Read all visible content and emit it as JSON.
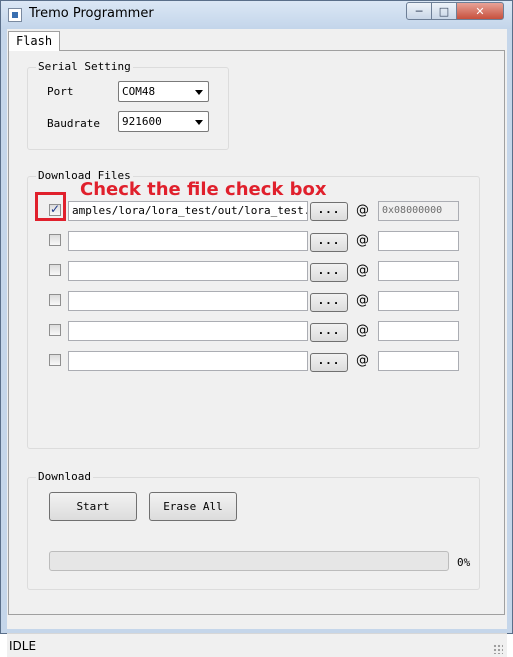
{
  "window": {
    "title": "Tremo Programmer",
    "minimize_glyph": "─",
    "maximize_glyph": "□",
    "close_glyph": "✕"
  },
  "tabs": [
    {
      "label": "Flash",
      "selected": true
    }
  ],
  "serial_setting": {
    "title": "Serial Setting",
    "port_label": "Port",
    "port_value": "COM48",
    "baudrate_label": "Baudrate",
    "baudrate_value": "921600"
  },
  "download_files": {
    "title": "Download Files",
    "browse_label": "...",
    "at_symbol": "@",
    "rows": [
      {
        "checked": true,
        "path": "amples/lora/lora_test/out/lora_test.bin",
        "address": "0x08000000",
        "address_disabled": true
      },
      {
        "checked": false,
        "path": "",
        "address": ""
      },
      {
        "checked": false,
        "path": "",
        "address": ""
      },
      {
        "checked": false,
        "path": "",
        "address": ""
      },
      {
        "checked": false,
        "path": "",
        "address": ""
      },
      {
        "checked": false,
        "path": "",
        "address": ""
      }
    ]
  },
  "download": {
    "title": "Download",
    "start_label": "Start",
    "erase_label": "Erase All",
    "progress_percent": 0,
    "progress_text": "0%"
  },
  "status": {
    "text": "IDLE"
  },
  "annotation": {
    "text": "Check the file check box",
    "color": "#e0202c"
  },
  "colors": {
    "progress_fill": "#06b025",
    "close_button": "#c7503d"
  },
  "icons": {
    "app": "app-icon",
    "checkmark": "✓",
    "combo_arrow": "chevron-down-icon"
  }
}
